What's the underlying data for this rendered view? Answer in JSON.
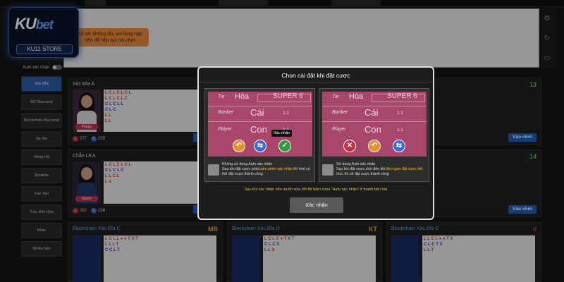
{
  "logo": {
    "brand_main": "KU",
    "brand_sub": "bet",
    "store": "KU11 STORE"
  },
  "notice": {
    "text": "Số dư không đủ, vui lòng nạp tiền để tiếp tục trò chơi"
  },
  "auto_confirm": {
    "label": "Auto xác nhận"
  },
  "menu": {
    "items": [
      {
        "label": "Xóc Đĩa",
        "active": true
      },
      {
        "label": "MC Baccarat",
        "active": false
      },
      {
        "label": "Blockchain Baccarat",
        "active": false
      },
      {
        "label": "Sic Bo",
        "active": false
      },
      {
        "label": "Rồng Hổ",
        "active": false
      },
      {
        "label": "Roulette",
        "active": false
      },
      {
        "label": "Fan Tan",
        "active": false
      },
      {
        "label": "Tróc Kim Hoa",
        "active": false
      },
      {
        "label": "Khác",
        "active": false
      },
      {
        "label": "Nhiều bàn",
        "active": false
      }
    ]
  },
  "games": {
    "a": {
      "title": "Xóc Đĩa A",
      "dealer": "Poppy",
      "count": "13",
      "red": "277",
      "blue": "235",
      "play": "Vào chơi"
    },
    "b": {
      "title": "Chẵn Lẻ A",
      "dealer": "Karen",
      "count": "14",
      "red": "262",
      "blue": "236",
      "play": "Vào chơi"
    },
    "c": {
      "title": "Blockchain Xóc Đĩa C",
      "tag": "MB"
    },
    "d": {
      "title": "Blockchain Xóc Đĩa D",
      "tag": "KT"
    },
    "e": {
      "title": "Blockchain Xóc Đĩa E",
      "tag": "0"
    }
  },
  "modal": {
    "title": "Chọn cài đặt khi đặt cược",
    "tooltip": "Xác nhận",
    "table": {
      "tie": "Tie",
      "tie_vi": "Hòa",
      "super": "SUPER 6",
      "banker": "Banker",
      "banker_vi": "Cái",
      "ratio1": "1:1",
      "player": "Player",
      "player_vi": "Con",
      "ratio2": "1:1"
    },
    "option_manual": {
      "line1": "Không sử dụng Auto xác nhận",
      "line2a": "Sau khi đặt cược phải ",
      "line2b": "bấm phím xác nhận",
      "line2c": " thì mới có thể đặt cược thành công"
    },
    "option_auto": {
      "line1": "Sử dụng Auto xác nhận",
      "line2a": "Sau khi đặt cược chờ đến khi ",
      "line2b": "thời gian đặt cược kết thúc",
      "line2c": " thì sẽ đặt cược thành công"
    },
    "note": "Sau khi xác nhận nếu muốn sửa đổi thì bấm chọn \"Auto xác nhận\" ở thanh bên trái",
    "confirm": "Xác nhận"
  },
  "colors": {
    "accent": "#2160b8",
    "highlight": "#f2c230",
    "table": "#a8466c"
  }
}
